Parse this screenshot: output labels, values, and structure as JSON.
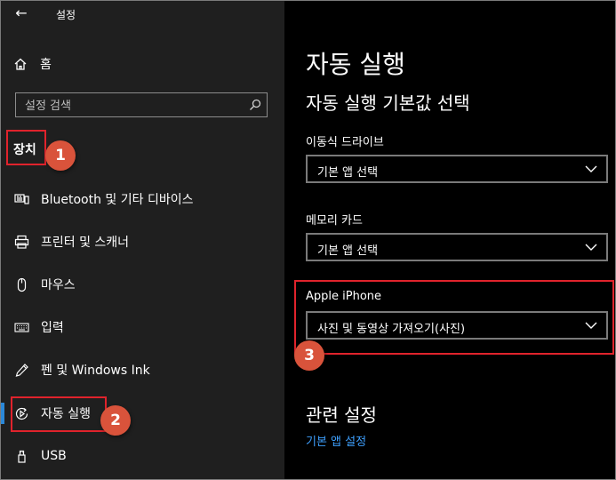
{
  "window": {
    "title": "설정",
    "back_icon": "back-arrow-icon"
  },
  "sidebar": {
    "home_label": "홈",
    "search_placeholder": "설정 검색",
    "section_title": "장치",
    "items": [
      {
        "label": "Bluetooth 및 기타 디바이스",
        "icon": "bluetooth-devices-icon"
      },
      {
        "label": "프린터 및 스캐너",
        "icon": "printer-icon"
      },
      {
        "label": "마우스",
        "icon": "mouse-icon"
      },
      {
        "label": "입력",
        "icon": "keyboard-icon"
      },
      {
        "label": "펜 및 Windows Ink",
        "icon": "pen-icon"
      },
      {
        "label": "자동 실행",
        "icon": "autoplay-icon"
      },
      {
        "label": "USB",
        "icon": "usb-icon"
      }
    ],
    "active_index": 5
  },
  "main": {
    "title": "자동 실행",
    "subtitle": "자동 실행 기본값 선택",
    "settings": [
      {
        "label": "이동식 드라이브",
        "value": "기본 앱 선택"
      },
      {
        "label": "메모리 카드",
        "value": "기본 앱 선택"
      },
      {
        "label": "Apple iPhone",
        "value": "사진 및 동영상 가져오기(사진)"
      }
    ],
    "related_title": "관련 설정",
    "related_link": "기본 앱 설정"
  },
  "annotations": {
    "badges": [
      "1",
      "2",
      "3"
    ],
    "highlight_color": "#e0232c",
    "badge_color": "#d9533b"
  },
  "colors": {
    "accent": "#2b88d8",
    "link": "#3ea0ff"
  }
}
